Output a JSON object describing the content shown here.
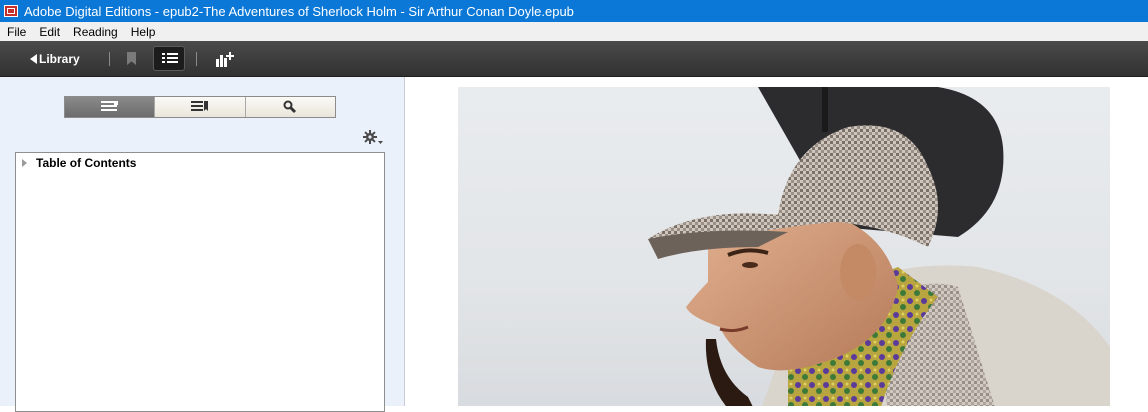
{
  "window": {
    "title": "Adobe Digital Editions - epub2-The Adventures of Sherlock Holm - Sir Arthur Conan Doyle.epub",
    "icon": "adobe-digital-editions-icon"
  },
  "menubar": {
    "items": [
      {
        "label": "File"
      },
      {
        "label": "Edit"
      },
      {
        "label": "Reading"
      },
      {
        "label": "Help"
      }
    ]
  },
  "toolbar": {
    "library_label": "Library",
    "icons": [
      "back-triangle-icon",
      "bookmark-icon",
      "table-of-contents-icon",
      "add-stats-icon"
    ],
    "active": "table-of-contents"
  },
  "sidebar": {
    "segments": [
      {
        "icon": "contents-list-icon",
        "selected": true
      },
      {
        "icon": "bookmarks-list-icon",
        "selected": false
      },
      {
        "icon": "search-icon",
        "selected": false
      }
    ],
    "options_icon": "gear-icon",
    "toc": {
      "items": [
        {
          "label": "Table of Contents",
          "expanded": false
        }
      ]
    }
  },
  "reader": {
    "content": "cover-image-sherlock-holmes"
  },
  "colors": {
    "titlebar": "#0b78d7",
    "toolbar": "#3c3c3c",
    "sidebar": "#ebf1fb"
  }
}
